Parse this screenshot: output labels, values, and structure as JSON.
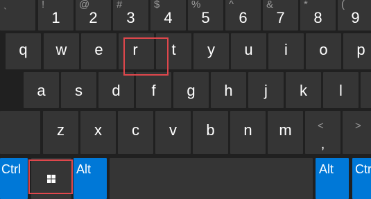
{
  "keyboard": {
    "number_row": [
      {
        "shift": "`",
        "main": ""
      },
      {
        "shift": "!",
        "main": "1"
      },
      {
        "shift": "@",
        "main": "2"
      },
      {
        "shift": "#",
        "main": "3"
      },
      {
        "shift": "$",
        "main": "4"
      },
      {
        "shift": "%",
        "main": "5"
      },
      {
        "shift": "^",
        "main": "6"
      },
      {
        "shift": "&",
        "main": "7"
      },
      {
        "shift": "*",
        "main": "8"
      },
      {
        "shift": "(",
        "main": "9"
      }
    ],
    "top_row": [
      "q",
      "w",
      "e",
      "r",
      "t",
      "y",
      "u",
      "i",
      "o",
      "p"
    ],
    "home_row": [
      "a",
      "s",
      "d",
      "f",
      "g",
      "h",
      "j",
      "k",
      "l"
    ],
    "bottom_row": [
      "z",
      "x",
      "c",
      "v",
      "b",
      "n",
      "m"
    ],
    "comma_key": {
      "top": "<",
      "bottom": ","
    },
    "period_key": {
      "top": ">"
    },
    "modifiers": {
      "ctrl_left": "Ctrl",
      "alt_left": "Alt",
      "alt_right": "Alt",
      "ctrl_right": "Ctrl"
    },
    "windows_key_icon": "windows-logo-icon",
    "highlighted_keys": [
      "r",
      "windows"
    ],
    "colors": {
      "background": "#202020",
      "key": "#353535",
      "accent": "#0078d7",
      "highlight": "#e0474c"
    }
  }
}
